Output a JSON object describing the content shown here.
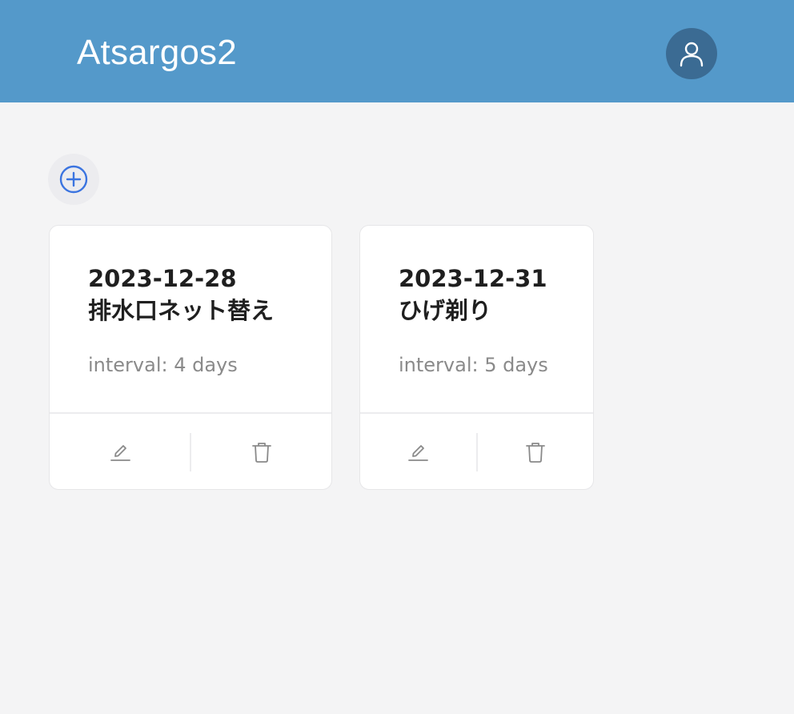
{
  "header": {
    "title": "Atsargos2",
    "avatar_icon": "user-icon",
    "background": "#5499ca"
  },
  "toolbar": {
    "add_icon": "plus-circle-icon",
    "accent": "#3b74e0"
  },
  "cards": [
    {
      "date": "2023-12-28",
      "task": "排水口ネット替え",
      "interval": "interval: 4 days",
      "edit_icon": "edit-icon",
      "delete_icon": "trash-icon"
    },
    {
      "date": "2023-12-31",
      "task": "ひげ剃り",
      "interval": "interval: 5 days",
      "edit_icon": "edit-icon",
      "delete_icon": "trash-icon"
    }
  ]
}
